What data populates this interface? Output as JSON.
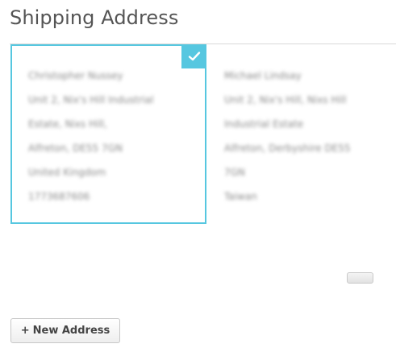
{
  "page": {
    "title": "Shipping Address"
  },
  "colors": {
    "accent": "#56c7e0",
    "title_text": "#555555",
    "address_text": "#8a8a8a"
  },
  "icons": {
    "selected": "check-icon",
    "add": "plus-icon"
  },
  "addresses": [
    {
      "selected": true,
      "lines": [
        "Christopher Nussey",
        "Unit 2, Nix's Hill Industrial",
        "Estate, Nixs Hill,",
        "Alfreton, DE55 7GN",
        "United Kingdom",
        "1773687606"
      ]
    },
    {
      "selected": false,
      "lines": [
        "Michael Lindsay",
        "Unit 2, Nix's Hill, Nixs Hill",
        "Industrial Estate",
        "Alfreton, Derbyshire DE55",
        "7GN",
        "Taiwan"
      ]
    }
  ],
  "actions": {
    "new_address_plus": "+",
    "new_address_label": "New Address"
  }
}
